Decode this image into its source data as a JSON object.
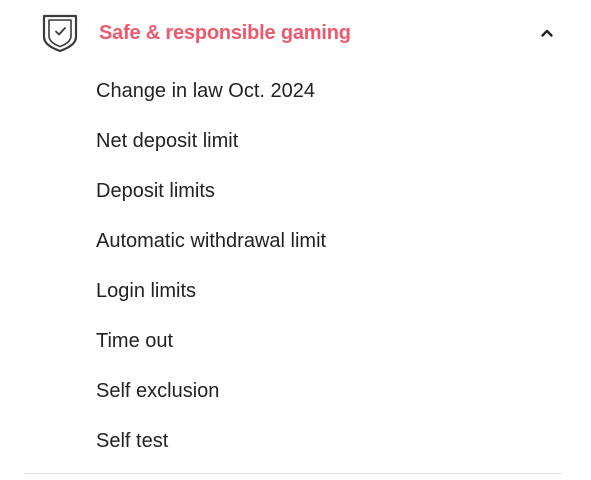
{
  "accordion": {
    "title": "Safe & responsible gaming",
    "expanded": true,
    "header_icon": "shield-check-icon",
    "toggle_icon": "chevron-up-icon",
    "accent_color": "#f0596b",
    "items": [
      {
        "label": "Change in law Oct. 2024"
      },
      {
        "label": "Net deposit limit"
      },
      {
        "label": "Deposit limits"
      },
      {
        "label": "Automatic withdrawal limit"
      },
      {
        "label": "Login limits"
      },
      {
        "label": "Time out"
      },
      {
        "label": "Self exclusion"
      },
      {
        "label": "Self test"
      }
    ]
  }
}
